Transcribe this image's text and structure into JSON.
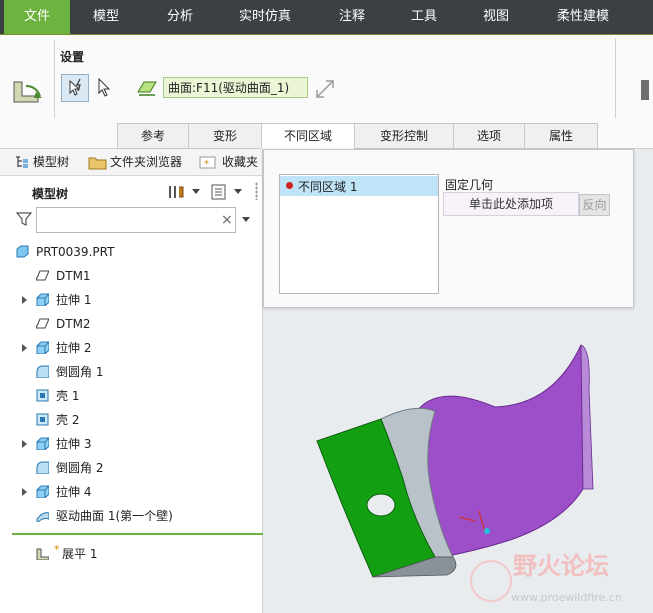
{
  "menubar": {
    "items": [
      "文件",
      "模型",
      "分析",
      "实时仿真",
      "注释",
      "工具",
      "视图",
      "柔性建模"
    ]
  },
  "ribbon": {
    "group_label": "设置",
    "surface_ref": "曲面:F11(驱动曲面_1)",
    "tabs": [
      "参考",
      "变形",
      "不同区域",
      "变形控制",
      "选项",
      "属性"
    ],
    "active_tab": "不同区域"
  },
  "left_tabs": [
    "模型树",
    "文件夹浏览器",
    "收藏夹"
  ],
  "model_tree": {
    "title": "模型树",
    "search_placeholder": "",
    "clear_glyph": "×",
    "items": [
      {
        "label": "PRT0039.PRT"
      },
      {
        "label": "DTM1"
      },
      {
        "label": "拉伸 1"
      },
      {
        "label": "DTM2"
      },
      {
        "label": "拉伸 2"
      },
      {
        "label": "倒圆角 1"
      },
      {
        "label": "壳 1"
      },
      {
        "label": "壳 2"
      },
      {
        "label": "拉伸 3"
      },
      {
        "label": "倒圆角 2"
      },
      {
        "label": "拉伸 4"
      },
      {
        "label": "驱动曲面 1(第一个壁)"
      }
    ],
    "insert_marker": "*",
    "after_item": "展平 1"
  },
  "popup": {
    "list_item": "不同区域 1",
    "fixed_geometry_label": "固定几何",
    "add_item_placeholder": "单击此处添加项",
    "reverse_button": "反向"
  },
  "watermark": {
    "title": "野火论坛",
    "url": "www.proewildfire.cn"
  },
  "colors": {
    "menubar_bg": "#3a4044",
    "active_menu": "#6db33f",
    "surface_ref_bg": "#eaf6d6",
    "green_face": "#12a012",
    "purple_face": "#9c4fc8",
    "list_selected": "#bfe4f7"
  }
}
